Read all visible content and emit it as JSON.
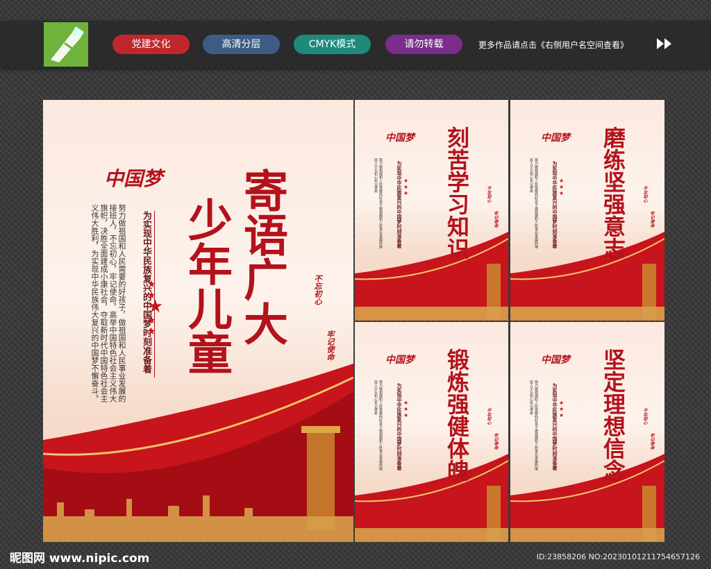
{
  "toolbar": {
    "tags": [
      "党建文化",
      "高清分层",
      "CMYK模式",
      "请勿转载"
    ],
    "more_text": "更多作品请点击《右侧用户名空间查看》",
    "arrows": "⯈⯈"
  },
  "main_poster": {
    "brand": "中国梦",
    "title_col1": "寄语广大",
    "title_col2": "少年儿童",
    "subtitle": "为实现中华民族复兴的中国梦时刻准备着",
    "body": [
      "努力做祖国和人民需要的好孩子，做祖国和人",
      "民事业发展的接班人，不忘初心，牢记使命，高举",
      "中国特色社会主义伟大旗帜，决胜全面建成小康社会，",
      "夺取新时代中国特色社会主义伟大胜利，为实",
      "现中华民族伟大复兴的中国梦不懈奋斗。"
    ],
    "seal_1": "不忘初心",
    "seal_2": "牢记使命"
  },
  "small_posters": [
    {
      "title": "刻苦学习知识"
    },
    {
      "title": "磨练坚强意志"
    },
    {
      "title": "锻炼强健体魄"
    },
    {
      "title": "坚定理想信念"
    }
  ],
  "small_common": {
    "brand": "中国梦",
    "subtitle": "为实现中华民族复兴的中国梦时刻准备着",
    "body": "努力做祖国和人民需要的好孩子做祖国和人民事业发展的接班人不忘初心牢记使命",
    "seal_1": "不忘初心",
    "seal_2": "牢记使命"
  },
  "footer": {
    "site": "昵图网 www.nipic.com",
    "id_line": "ID:23858206 NO:20230101211754657126"
  }
}
